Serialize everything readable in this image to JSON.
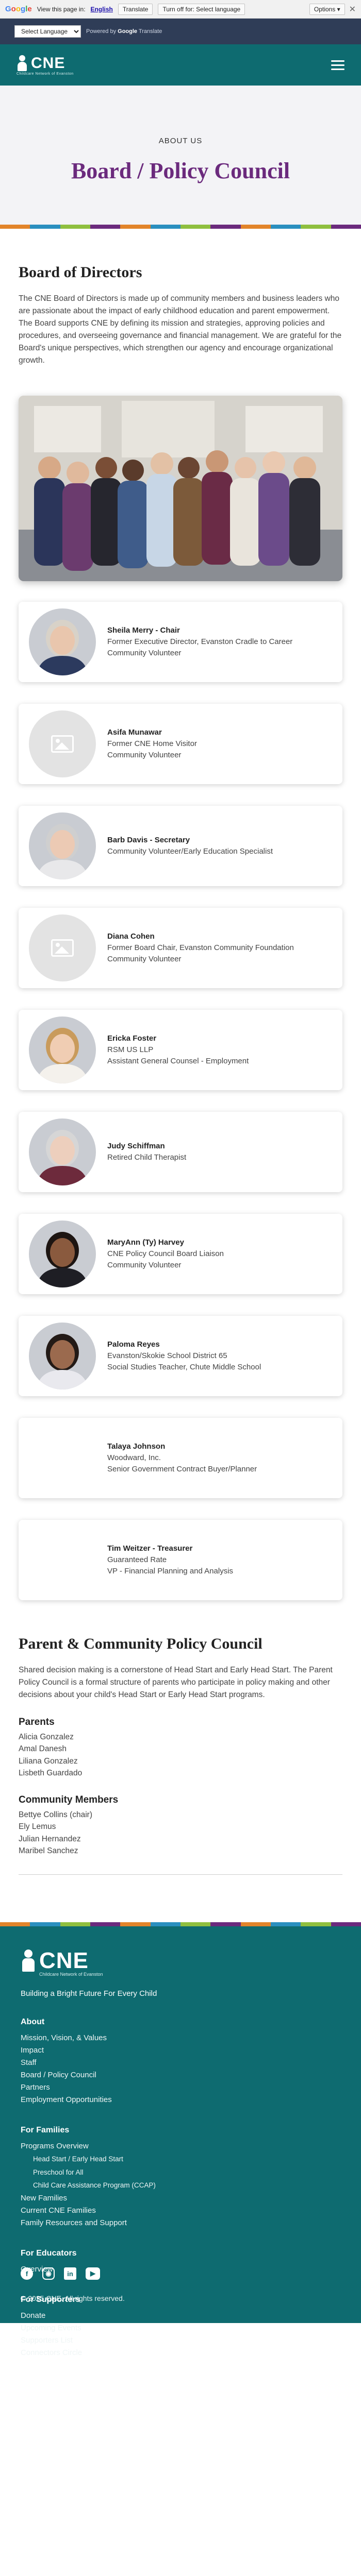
{
  "google_bar": {
    "logo_letters": [
      "G",
      "o",
      "o",
      "g",
      "l",
      "e"
    ],
    "view_prefix": "View this page in:",
    "language": "English",
    "translate_button": "Translate",
    "turn_off_button": "Turn off for: Select language",
    "options_button": "Options ▾",
    "close": "✕"
  },
  "language_bar": {
    "select_label": "Select Language",
    "powered_by": "Powered by",
    "powered_brand": "Google",
    "powered_suffix": "Translate"
  },
  "header": {
    "logo_text": "CNE",
    "logo_subtitle": "Childcare Network of Evanston"
  },
  "hero": {
    "eyebrow": "ABOUT US",
    "title": "Board / Policy Council",
    "stripe_colors": [
      "#e2842a",
      "#2a8fbf",
      "#8fbf3f",
      "#6b2a7d",
      "#e2842a",
      "#2a8fbf",
      "#8fbf3f",
      "#6b2a7d",
      "#e2842a",
      "#2a8fbf",
      "#8fbf3f",
      "#6b2a7d"
    ]
  },
  "board": {
    "title": "Board of Directors",
    "description": "The CNE Board of Directors is made up of community members and business leaders who are passionate about the impact of early childhood education and parent empowerment. The Board supports CNE by defining its mission and strategies, approving policies and procedures, and overseeing governance and financial management. We are grateful for the Board's unique perspectives, which strengthen our agency and encourage organizational growth.",
    "members": [
      {
        "name": "Sheila Merry - Chair",
        "line1": "Former Executive Director, Evanston Cradle to Career",
        "line2": "Community Volunteer",
        "avatar": "photo",
        "skin": "#e9c6ad",
        "hair": "#d8d2c8",
        "shirt": "#2c3a5e"
      },
      {
        "name": "Asifa Munawar",
        "line1": "Former CNE Home Visitor",
        "line2": "Community Volunteer",
        "avatar": "placeholder"
      },
      {
        "name": "Barb Davis - Secretary",
        "line1": "Community Volunteer/Early Education Specialist",
        "line2": "",
        "avatar": "photo",
        "skin": "#eccab4",
        "hair": "#cfcfcf",
        "shirt": "#e8e8ea"
      },
      {
        "name": "Diana Cohen",
        "line1": "Former Board Chair, Evanston Community Foundation",
        "line2": "Community Volunteer",
        "avatar": "placeholder"
      },
      {
        "name": "Ericka Foster",
        "line1": "RSM US LLP",
        "line2": "Assistant General Counsel - Employment",
        "avatar": "photo",
        "skin": "#f0cdb3",
        "hair": "#c99b5c",
        "shirt": "#f4f1ec"
      },
      {
        "name": "Judy Schiffman",
        "line1": "Retired Child Therapist",
        "line2": "",
        "avatar": "photo",
        "skin": "#edcfbd",
        "hair": "#d6d6d6",
        "shirt": "#6d2a3c"
      },
      {
        "name": "MaryAnn (Ty) Harvey",
        "line1": "CNE Policy Council Board Liaison",
        "line2": "Community Volunteer",
        "avatar": "photo",
        "skin": "#8a5a3e",
        "hair": "#1d1512",
        "shirt": "#1e1e24"
      },
      {
        "name": "Paloma Reyes",
        "line1": "Evanston/Skokie School District 65",
        "line2": "Social Studies Teacher, Chute Middle School",
        "avatar": "photo",
        "skin": "#9b6a4e",
        "hair": "#231a16",
        "shirt": "#e9e9ee"
      },
      {
        "name": "Talaya Johnson",
        "line1": "Woodward, Inc.",
        "line2": "Senior Government Contract Buyer/Planner",
        "avatar": "blank"
      },
      {
        "name": "Tim Weitzer - Treasurer",
        "line1": "Guaranteed Rate",
        "line2": "VP - Financial Planning and Analysis",
        "avatar": "blank"
      }
    ]
  },
  "policy_council": {
    "title": "Parent & Community Policy Council",
    "description": "Shared decision making is a cornerstone of Head Start and Early Head Start. The Parent Policy Council is a formal structure of parents who participate in policy making and other decisions about your child's Head Start or Early Head Start programs.",
    "parents_heading": "Parents",
    "parents": [
      "Alicia Gonzalez",
      "Amal Danesh",
      "Liliana Gonzalez",
      "Lisbeth Guardado"
    ],
    "community_heading": "Community Members",
    "community": [
      "Bettye Collins (chair)",
      "Ely Lemus",
      "Julian Hernandez",
      "Maribel Sanchez"
    ]
  },
  "footer": {
    "logo_text": "CNE",
    "logo_subtitle": "Childcare Network of Evanston",
    "tagline": "Building a Bright Future For Every Child",
    "sections": [
      {
        "heading": "About",
        "items": [
          {
            "label": "Mission, Vision, & Values",
            "sub": false
          },
          {
            "label": "Impact",
            "sub": false
          },
          {
            "label": "Staff",
            "sub": false
          },
          {
            "label": "Board / Policy Council",
            "sub": false
          },
          {
            "label": "Partners",
            "sub": false
          },
          {
            "label": "Employment Opportunities",
            "sub": false
          }
        ]
      },
      {
        "heading": "For Families",
        "items": [
          {
            "label": "Programs Overview",
            "sub": false
          },
          {
            "label": "Head Start / Early Head Start",
            "sub": true
          },
          {
            "label": "Preschool for All",
            "sub": true
          },
          {
            "label": "Child Care Assistance Program (CCAP)",
            "sub": true
          },
          {
            "label": "New Families",
            "sub": false
          },
          {
            "label": "Current CNE Families",
            "sub": false
          },
          {
            "label": "Family Resources and Support",
            "sub": false
          }
        ]
      },
      {
        "heading": "For Educators",
        "items": [
          {
            "label": "Overview",
            "sub": false
          }
        ]
      },
      {
        "heading": "For Supporters",
        "items": [
          {
            "label": "Donate",
            "sub": false
          },
          {
            "label": "Upcoming Events",
            "sub": false
          },
          {
            "label": "Supporters List",
            "sub": false
          },
          {
            "label": "Connectors Circle",
            "sub": false
          }
        ]
      }
    ],
    "social": [
      {
        "name": "facebook-icon",
        "glyph": "f",
        "cls": "fb"
      },
      {
        "name": "instagram-icon",
        "glyph": "◉",
        "cls": "ig"
      },
      {
        "name": "linkedin-icon",
        "glyph": "in",
        "cls": "li"
      },
      {
        "name": "youtube-icon",
        "glyph": "▶",
        "cls": "yt"
      }
    ],
    "copyright": "© 2025 CNE. All rights reserved."
  }
}
